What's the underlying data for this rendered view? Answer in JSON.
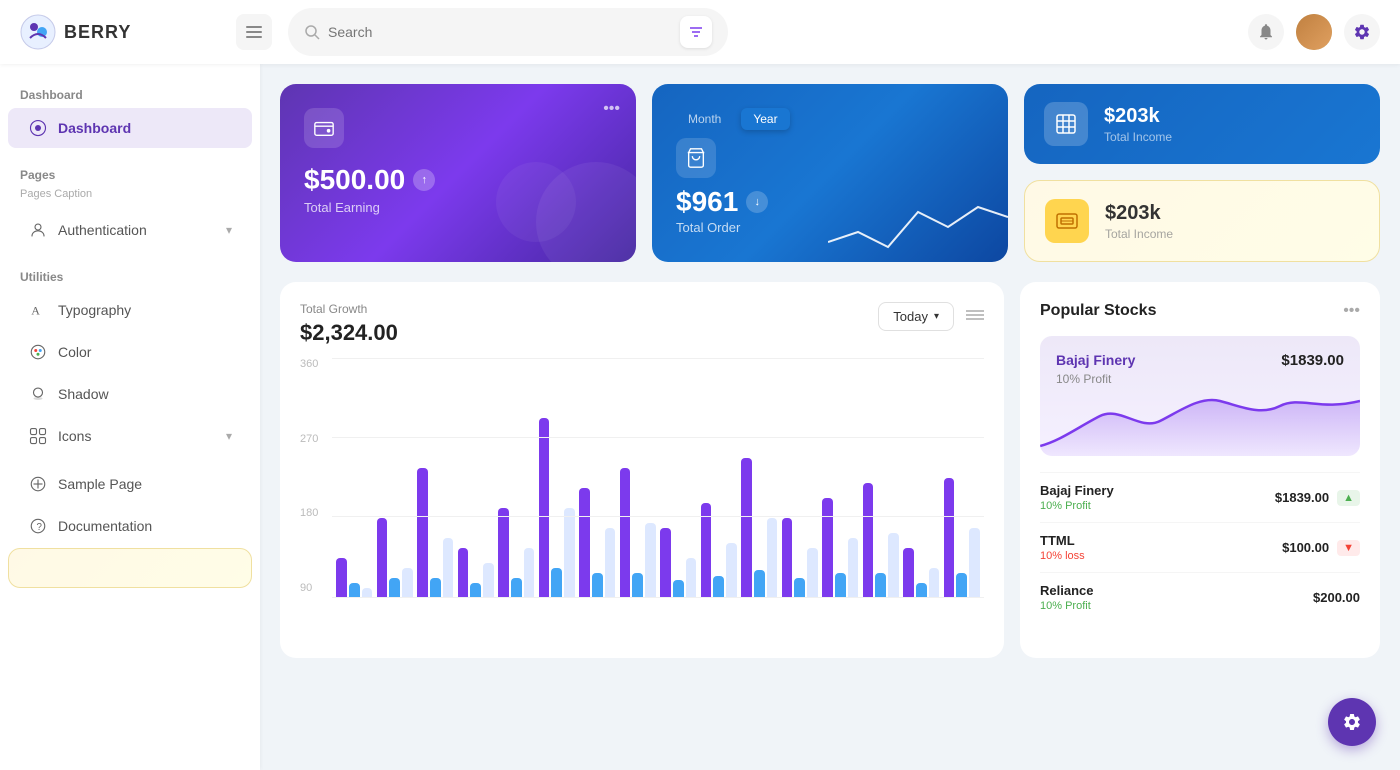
{
  "topbar": {
    "logo_text": "BERRY",
    "search_placeholder": "Search",
    "menu_icon": "☰",
    "notif_icon": "🔔",
    "settings_icon": "⚙"
  },
  "sidebar": {
    "section_dashboard": "Dashboard",
    "item_dashboard": "Dashboard",
    "section_pages": "Pages",
    "pages_caption": "Pages Caption",
    "item_authentication": "Authentication",
    "section_utilities": "Utilities",
    "item_typography": "Typography",
    "item_color": "Color",
    "item_shadow": "Shadow",
    "item_icons": "Icons",
    "item_sample": "Sample Page",
    "item_docs": "Documentation"
  },
  "cards": {
    "earning_amount": "$500.00",
    "earning_label": "Total Earning",
    "order_amount": "$961",
    "order_label": "Total Order",
    "order_toggle_month": "Month",
    "order_toggle_year": "Year",
    "income_blue_amount": "$203k",
    "income_blue_label": "Total Income",
    "income_yellow_amount": "$203k",
    "income_yellow_label": "Total Income"
  },
  "chart": {
    "title_label": "Total Growth",
    "amount": "$2,324.00",
    "today_btn": "Today",
    "y_labels": [
      "360",
      "270",
      "180",
      "90"
    ],
    "bars": [
      {
        "p": 40,
        "b": 15,
        "l": 10
      },
      {
        "p": 80,
        "b": 20,
        "l": 30
      },
      {
        "p": 130,
        "b": 20,
        "l": 60
      },
      {
        "p": 50,
        "b": 15,
        "l": 35
      },
      {
        "p": 90,
        "b": 20,
        "l": 50
      },
      {
        "p": 180,
        "b": 30,
        "l": 90
      },
      {
        "p": 110,
        "b": 25,
        "l": 70
      },
      {
        "p": 130,
        "b": 25,
        "l": 75
      },
      {
        "p": 70,
        "b": 18,
        "l": 40
      },
      {
        "p": 95,
        "b": 22,
        "l": 55
      },
      {
        "p": 140,
        "b": 28,
        "l": 80
      },
      {
        "p": 80,
        "b": 20,
        "l": 50
      },
      {
        "p": 100,
        "b": 25,
        "l": 60
      },
      {
        "p": 115,
        "b": 25,
        "l": 65
      },
      {
        "p": 50,
        "b": 15,
        "l": 30
      },
      {
        "p": 120,
        "b": 25,
        "l": 70
      }
    ]
  },
  "stocks": {
    "title": "Popular Stocks",
    "featured_name": "Bajaj Finery",
    "featured_price": "$1839.00",
    "featured_profit": "10% Profit",
    "rows": [
      {
        "name": "Bajaj Finery",
        "price": "$1839.00",
        "profit": "10% Profit",
        "up": true
      },
      {
        "name": "TTML",
        "price": "$100.00",
        "profit": "10% loss",
        "up": false
      },
      {
        "name": "Reliance",
        "price": "$200.00",
        "profit": "10% Profit",
        "up": true
      }
    ]
  }
}
